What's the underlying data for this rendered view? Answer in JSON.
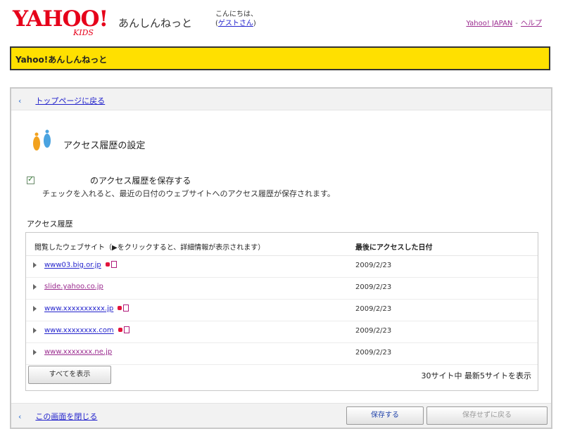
{
  "header": {
    "logo_main": "YAHOO!",
    "logo_sub": "KIDS",
    "service_title": "あんしんねっと",
    "greeting": "こんにちは、",
    "guest": "ゲストさん",
    "links": [
      "Yahoo! JAPAN",
      "ヘルプ"
    ]
  },
  "bar": {
    "title": "Yahoo!あんしんねっと"
  },
  "nav": {
    "back_link": "トップページに戻る"
  },
  "section": {
    "heading": "アクセス履歴の設定",
    "checkbox_checked": true,
    "checkbox_label": "のアクセス履歴を保存する",
    "checkbox_desc": "チェックを入れると、最近の日付のウェブサイトへのアクセス履歴が保存されます。",
    "history_label": "アクセス履歴"
  },
  "table": {
    "col_site": "閲覧したウェブサイト（▶をクリックすると、詳細情報が表示されます）",
    "col_date": "最後にアクセスした日付",
    "rows": [
      {
        "site": "www03.big.or.jp",
        "date": "2009/2/23",
        "visited": false,
        "icons": [
          "red",
          "frame"
        ]
      },
      {
        "site": "slide.yahoo.co.jp",
        "date": "2009/2/23",
        "visited": true,
        "icons": []
      },
      {
        "site": "www.xxxxxxxxxx.jp",
        "date": "2009/2/23",
        "visited": false,
        "icons": [
          "red",
          "frame"
        ]
      },
      {
        "site": "www.xxxxxxxx.com",
        "date": "2009/2/23",
        "visited": false,
        "icons": [
          "red",
          "frame"
        ]
      },
      {
        "site": "www.xxxxxxx.ne.jp",
        "date": "2009/2/23",
        "visited": true,
        "icons": []
      }
    ],
    "show_all": "すべてを表示",
    "count_note": "30サイト中 最新5サイトを表示"
  },
  "footer": {
    "link": "この画面を閉じる",
    "save_button": "保存する",
    "cancel_button": "保存せずに戻る"
  },
  "colors": {
    "yahoo_red": "#e6001a",
    "bar_yellow": "#ffe000",
    "link": "#2222cc"
  }
}
